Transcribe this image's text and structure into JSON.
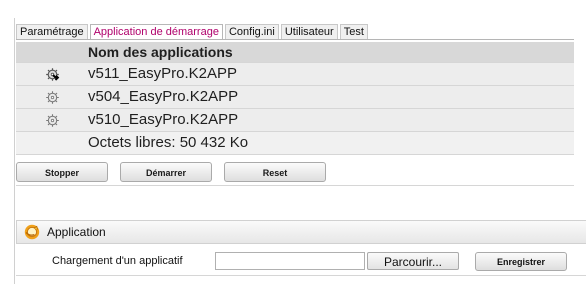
{
  "tabs": [
    {
      "label": "Paramétrage",
      "active": false
    },
    {
      "label": "Application de démarrage",
      "active": true
    },
    {
      "label": "Config.ini",
      "active": false
    },
    {
      "label": "Utilisateur",
      "active": false
    },
    {
      "label": "Test",
      "active": false
    }
  ],
  "applications_table": {
    "header": "Nom des applications",
    "rows": [
      {
        "name": "v511_EasyPro.K2APP",
        "icon": "running-gear-icon"
      },
      {
        "name": "v504_EasyPro.K2APP",
        "icon": "gear-icon"
      },
      {
        "name": "v510_EasyPro.K2APP",
        "icon": "gear-icon"
      }
    ],
    "free_space": "Octets libres: 50 432 Ko"
  },
  "actions": {
    "stop": "Stopper",
    "start": "Démarrer",
    "reset": "Reset"
  },
  "application_section": {
    "title": "Application",
    "icon": "application-icon",
    "field_label": "Chargement d'un applicatif",
    "browse_label": "Parcourir...",
    "save_label": "Enregistrer"
  },
  "colors": {
    "active_tab": "#b0006b",
    "header_gray": "#d8d8d8",
    "row_gray": "#ededed",
    "section_icon": "#f0a11a"
  }
}
